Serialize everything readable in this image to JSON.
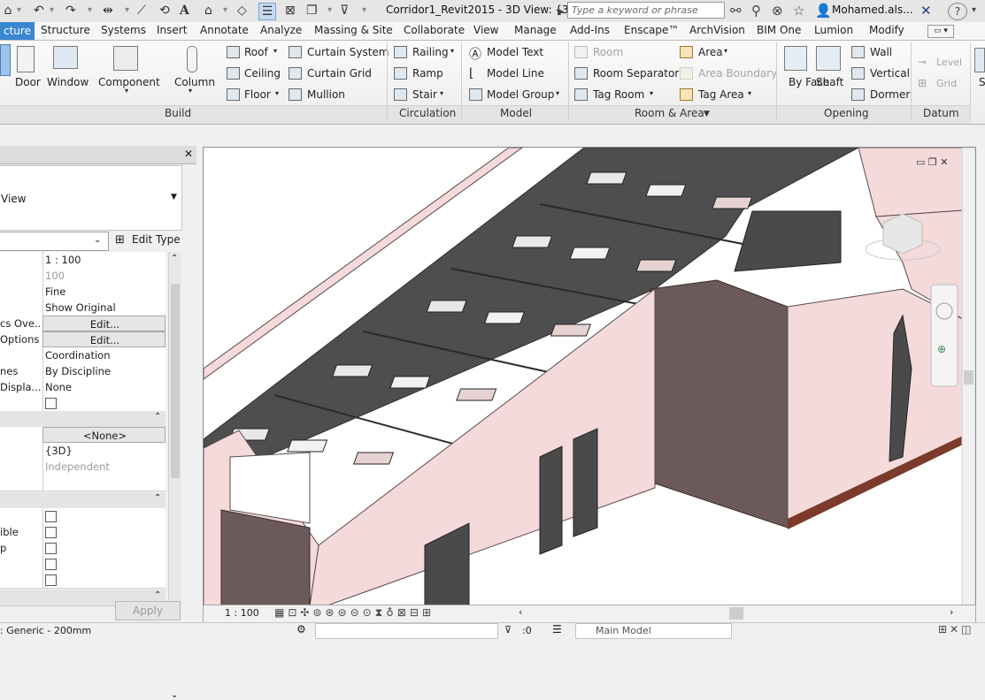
{
  "window": {
    "title": "Corridor1_Revit2015 - 3D View: {3D}",
    "search_placeholder": "Type a keyword or phrase",
    "user": "Mohamed.als...",
    "help": "?"
  },
  "quick_access": [
    "open-icon",
    "undo-icon",
    "redo-icon",
    "measure-icon",
    "dimension-icon",
    "tag-icon",
    "text-icon",
    "3d-view-icon",
    "section-icon",
    "thin-lines-icon",
    "close-hidden-icon",
    "switch-windows-icon",
    "customize-icon"
  ],
  "tabs": [
    "cture",
    "Structure",
    "Systems",
    "Insert",
    "Annotate",
    "Analyze",
    "Massing & Site",
    "Collaborate",
    "View",
    "Manage",
    "Add-Ins",
    "Enscape™",
    "ArchVision",
    "BIM One",
    "Lumion",
    "Modify"
  ],
  "ribbon": {
    "build": {
      "title": "Build",
      "big": [
        "Door",
        "Window",
        "Component",
        "Column"
      ],
      "small": [
        "Roof",
        "Ceiling",
        "Floor",
        "Curtain System",
        "Curtain Grid",
        "Mullion"
      ]
    },
    "circulation": {
      "title": "Circulation",
      "items": [
        "Railing",
        "Ramp",
        "Stair"
      ]
    },
    "model": {
      "title": "Model",
      "items": [
        "Model Text",
        "Model Line",
        "Model Group"
      ]
    },
    "room_area": {
      "title": "Room & Area",
      "items": [
        "Room",
        "Room Separator",
        "Tag Room",
        "Area",
        "Area Boundary",
        "Tag Area"
      ]
    },
    "opening": {
      "title": "Opening",
      "big": [
        "By Face",
        "Shaft"
      ],
      "items": [
        "Wall",
        "Vertical",
        "Dormer"
      ]
    },
    "datum": {
      "title": "Datum",
      "items": [
        "Level",
        "Grid"
      ]
    }
  },
  "properties": {
    "type_name": "View",
    "edit_type": "Edit Type",
    "rows": [
      {
        "k": "",
        "v": "1 : 100",
        "kind": "text"
      },
      {
        "k": "",
        "v": "100",
        "kind": "dim"
      },
      {
        "k": "",
        "v": "Fine",
        "kind": "text"
      },
      {
        "k": "",
        "v": "Show Original",
        "kind": "text"
      },
      {
        "k": "cs Ove...",
        "v": "Edit...",
        "kind": "btn"
      },
      {
        "k": "Options",
        "v": "Edit...",
        "kind": "btn"
      },
      {
        "k": "",
        "v": "Coordination",
        "kind": "text"
      },
      {
        "k": "nes",
        "v": "By Discipline",
        "kind": "text"
      },
      {
        "k": "Displa...",
        "v": "None",
        "kind": "text"
      }
    ],
    "rows2": [
      {
        "k": "",
        "v": "<None>",
        "kind": "btn"
      },
      {
        "k": "",
        "v": "{3D}",
        "kind": "text"
      },
      {
        "k": "",
        "v": "Independent",
        "kind": "dim"
      }
    ],
    "rows3": [
      {
        "k": "ible"
      },
      {
        "k": "p"
      }
    ],
    "apply": "Apply"
  },
  "viewbar": {
    "scale": "1 : 100"
  },
  "status": {
    "left": ": Generic - 200mm",
    "filter": ":0",
    "workset": "Main Model"
  },
  "colors": {
    "wall_pink": "#f3dcdc",
    "ceiling_dark": "#505050",
    "accent": "#3a86cf",
    "wall_brown": "#6e5553"
  }
}
